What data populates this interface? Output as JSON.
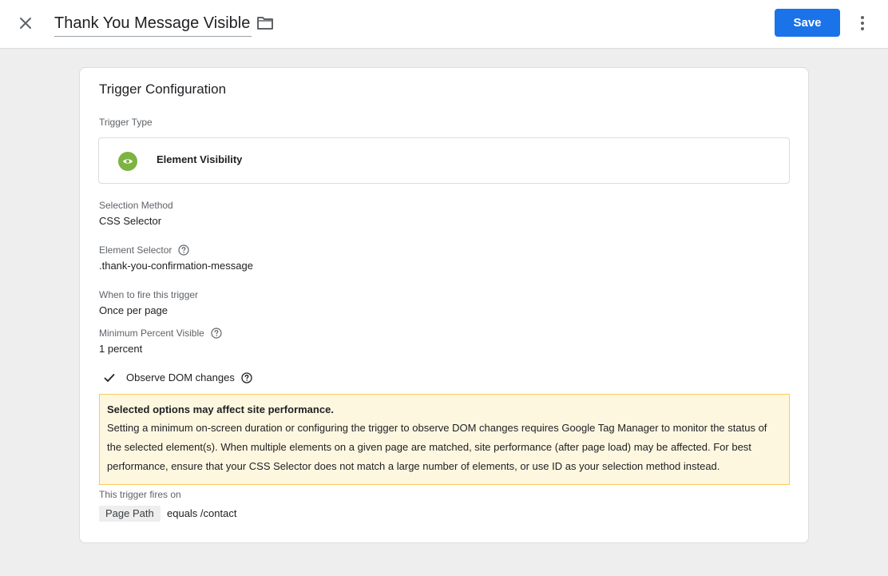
{
  "header": {
    "title": "Thank You Message Visible",
    "save_label": "Save",
    "icons": {
      "close": "close-icon",
      "folder": "folder-icon",
      "more": "more-vert-icon"
    }
  },
  "card": {
    "title": "Trigger Configuration",
    "trigger_type": {
      "label": "Trigger Type",
      "value": "Element Visibility",
      "icon": "eye-icon",
      "icon_color": "#7cb342"
    },
    "selection_method": {
      "label": "Selection Method",
      "value": "CSS Selector"
    },
    "element_selector": {
      "label": "Element Selector",
      "value": ".thank-you-confirmation-message"
    },
    "when_to_fire": {
      "label": "When to fire this trigger",
      "value": "Once per page"
    },
    "min_percent_visible": {
      "label": "Minimum Percent Visible",
      "value": "1 percent"
    },
    "observe_dom": {
      "label": "Observe DOM changes",
      "checked": true
    },
    "warning": {
      "title": "Selected options may affect site performance.",
      "body": "Setting a minimum on-screen duration or configuring the trigger to observe DOM changes requires Google Tag Manager to monitor the status of the selected element(s). When multiple elements on a given page are matched, site performance (after page load) may be affected. For best performance, ensure that your CSS Selector does not match a large number of elements, or use ID as your selection method instead."
    },
    "fires_on": {
      "label": "This trigger fires on",
      "variable": "Page Path",
      "condition": "equals /contact"
    }
  },
  "colors": {
    "primary": "#1a73e8",
    "warning_bg": "#fef7e0",
    "warning_border": "#f9cb5a"
  }
}
